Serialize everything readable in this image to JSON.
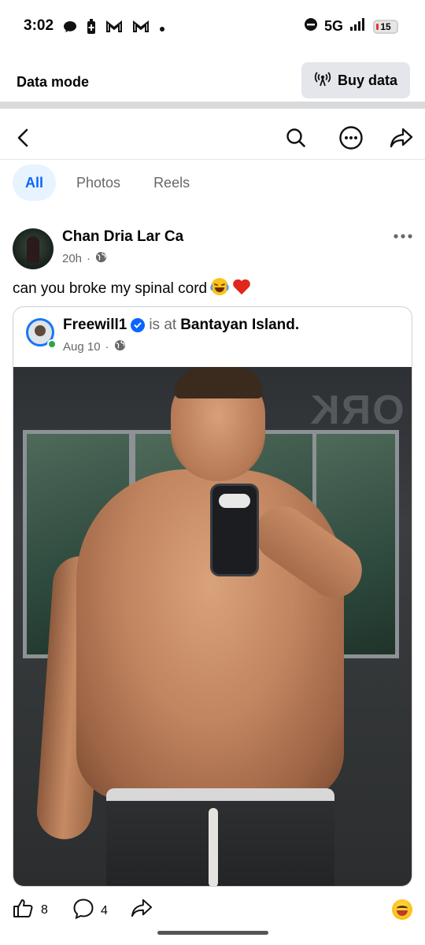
{
  "status_bar": {
    "time": "3:02",
    "network": "5G",
    "battery": "15",
    "left_icons": [
      "chat-bubble-icon",
      "battery-saver-icon",
      "gmail-icon",
      "gmail-icon",
      "dot-icon"
    ],
    "right_icons": [
      "do-not-disturb-icon",
      "signal-icon",
      "battery-icon"
    ]
  },
  "data_bar": {
    "label": "Data mode",
    "buy_button": "Buy data",
    "buy_icon": "broadcast-icon"
  },
  "nav": {
    "icons": [
      "back-icon",
      "search-icon",
      "more-options-icon",
      "share-icon"
    ]
  },
  "tabs": [
    {
      "label": "All",
      "active": true
    },
    {
      "label": "Photos",
      "active": false
    },
    {
      "label": "Reels",
      "active": false
    }
  ],
  "post": {
    "author": "Chan Dria Lar Ca",
    "time": "20h",
    "separator": "·",
    "privacy_icon": "globe-icon",
    "text": "can you broke my spinal cord",
    "emojis": [
      "laughing-crying-emoji",
      "red-heart-emoji"
    ],
    "shared": {
      "author": "Freewill1",
      "verified": true,
      "is_at": "is at",
      "location": "Bantayan Island",
      "period": ".",
      "date": "Aug 10",
      "separator": "·",
      "privacy_icon": "globe-icon",
      "photo_sign_text": "ORK"
    },
    "actions": {
      "likes": "8",
      "comments": "4",
      "like_icon": "thumbs-up-icon",
      "comment_icon": "comment-icon",
      "share_icon": "share-icon",
      "reaction_icon": "laughing-reaction-icon"
    }
  },
  "colors": {
    "accent_blue": "#0866ff",
    "tab_active_bg": "#e7f3ff",
    "secondary_text": "#65676b",
    "online_green": "#31a24c"
  }
}
